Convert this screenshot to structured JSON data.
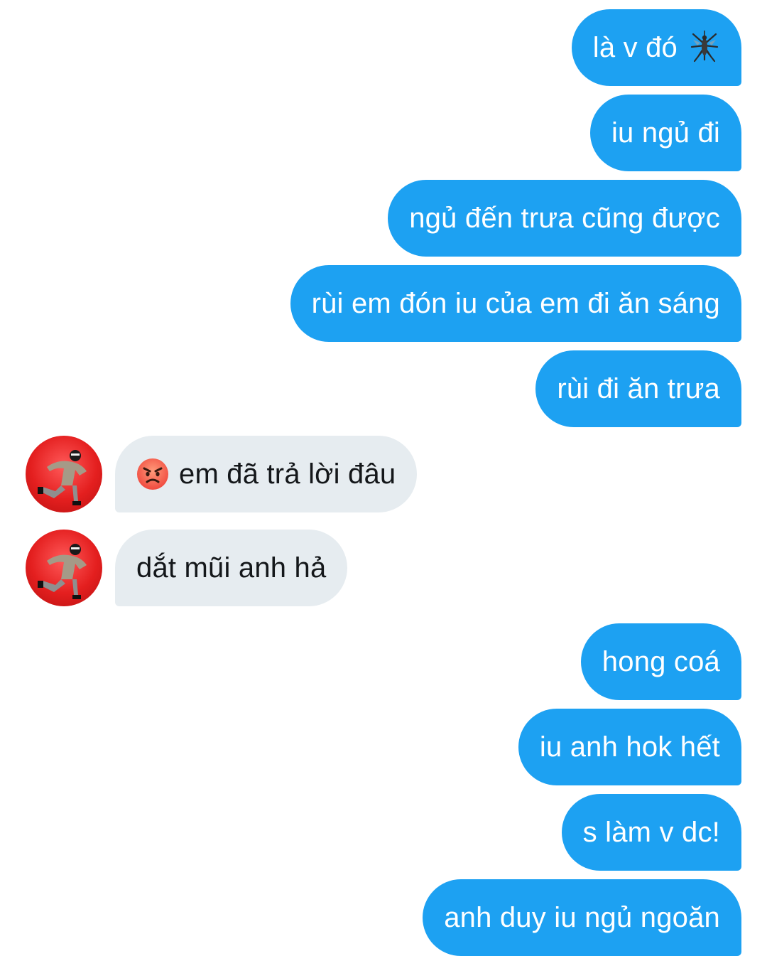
{
  "conversation": {
    "messages": [
      {
        "sender": "self",
        "text": "là v đó",
        "emoji": "mosquito-icon"
      },
      {
        "sender": "self",
        "text": "iu ngủ đi"
      },
      {
        "sender": "self",
        "text": "ngủ đến trưa cũng được"
      },
      {
        "sender": "self",
        "text": "rùi em đón iu của em đi ăn sáng"
      },
      {
        "sender": "self",
        "text": "rùi đi ăn trưa"
      },
      {
        "sender": "other",
        "text": "em đã trả lời đâu",
        "emoji": "angry-face-icon"
      },
      {
        "sender": "other",
        "text": "dắt mũi anh hả"
      },
      {
        "sender": "self",
        "text": "hong coá"
      },
      {
        "sender": "self",
        "text": "iu anh hok hết"
      },
      {
        "sender": "self",
        "text": "s làm v dc!"
      },
      {
        "sender": "self",
        "text": "anh duy iu ngủ ngoăn"
      }
    ]
  },
  "colors": {
    "outgoing_bubble": "#1da1f2",
    "incoming_bubble": "#e6ecf0",
    "outgoing_text": "#ffffff",
    "incoming_text": "#14171a",
    "avatar_background": "#e41f1f"
  }
}
